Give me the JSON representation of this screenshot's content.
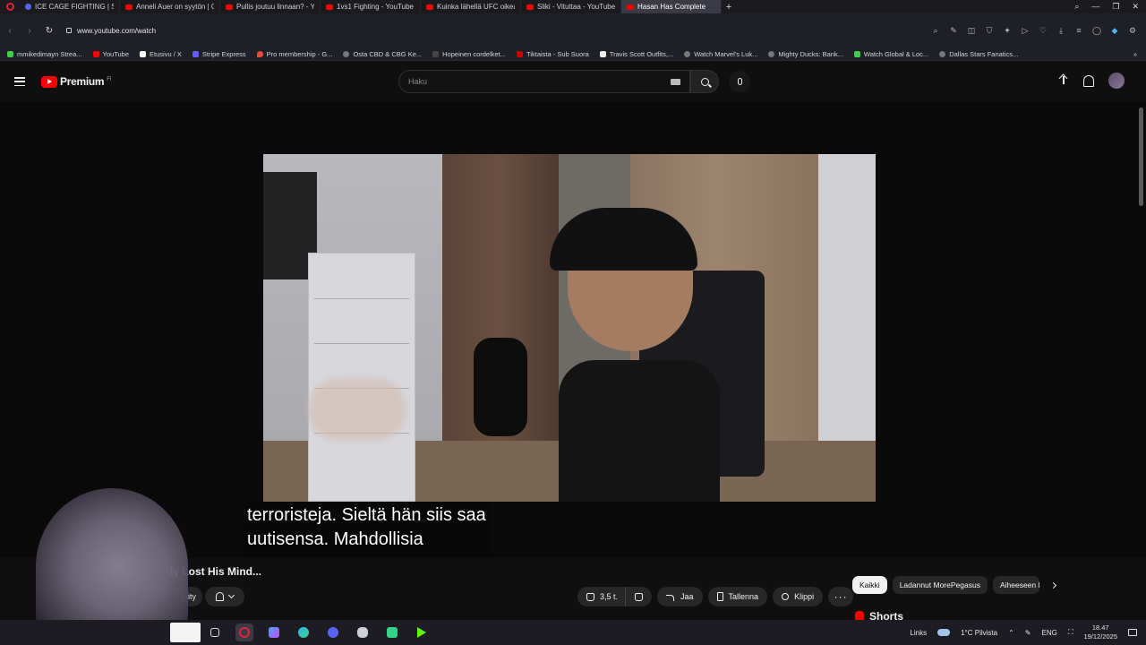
{
  "browser": {
    "tabs": [
      {
        "title": "ICE CAGE FIGHTING | Suo",
        "icon": "discord-icon"
      },
      {
        "title": "Anneli Auer on syytön | O",
        "icon": "youtube-icon"
      },
      {
        "title": "Pullis joutuu linnaan? - Yo",
        "icon": "youtube-icon"
      },
      {
        "title": "1vs1 Fighting - YouTube",
        "icon": "youtube-icon"
      },
      {
        "title": "Kuinka lähellä UFC oikeas",
        "icon": "youtube-icon"
      },
      {
        "title": "Sliki - Vituttaa - YouTube",
        "icon": "youtube-icon"
      },
      {
        "title": "Hasan Has Complete",
        "icon": "audio-youtube-icon",
        "active": true
      }
    ],
    "url": "www.youtube.com/watch",
    "bookmarks": [
      {
        "label": "mmikedimayn Strea...",
        "icon": "green"
      },
      {
        "label": "YouTube",
        "icon": "yt"
      },
      {
        "label": "Etusivu / X",
        "icon": "x"
      },
      {
        "label": "Stripe Express",
        "icon": "blue"
      },
      {
        "label": "Pro membership - G...",
        "icon": "pin"
      },
      {
        "label": "Osta CBD & CBG Ke...",
        "icon": "gray"
      },
      {
        "label": "Hopeinen cordelket...",
        "icon": "dark"
      },
      {
        "label": "Tiktaista - Sub Suora",
        "icon": "yt"
      },
      {
        "label": "Travis Scott Outfits,...",
        "icon": "white"
      },
      {
        "label": "Watch Marvel's Luk...",
        "icon": "gray"
      },
      {
        "label": "Mighty Ducks: Bank...",
        "icon": "gray"
      },
      {
        "label": "Watch Global & Loc...",
        "icon": "green"
      },
      {
        "label": "Dallas Stars Fanatics...",
        "icon": "gray"
      }
    ]
  },
  "youtube": {
    "brand": "Premium",
    "country": "FI",
    "search_placeholder": "Haku",
    "video_title_partial": "ly Lost His Mind...",
    "subscribe_label": "Liity",
    "subtitles": [
      "terroristeja.  Sieltä hän siis saa",
      "uutisensa.  Mahdollisia"
    ],
    "actions": {
      "likes": "3,5 t.",
      "share": "Jaa",
      "save": "Tallenna",
      "clip": "Klippi"
    },
    "chips": [
      "Kaikki",
      "Ladannut MorePegasus",
      "Aiheeseen li"
    ],
    "shorts_label": "Shorts",
    "colors": {
      "brand_red": "#ff0000",
      "bg": "#0f0f0f"
    }
  },
  "taskbar": {
    "links_label": "Links",
    "weather": "1°C  Pilvista",
    "language": "ENG",
    "time": "18.47",
    "date": "19/12/2025"
  }
}
